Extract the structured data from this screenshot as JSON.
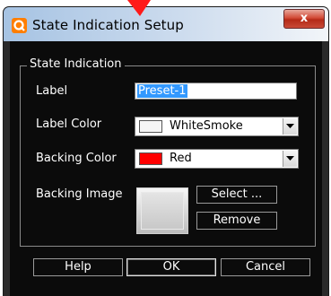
{
  "window": {
    "title": "State Indication Setup",
    "close_label": "x"
  },
  "group": {
    "title": "State Indication"
  },
  "fields": {
    "label": {
      "label": "Label",
      "value": "Preset-1"
    },
    "label_color": {
      "label": "Label Color",
      "value": "WhiteSmoke",
      "swatch": "#f5f5f5"
    },
    "backing_color": {
      "label": "Backing Color",
      "value": "Red",
      "swatch": "#ff0000"
    },
    "backing_image": {
      "label": "Backing Image"
    }
  },
  "buttons": {
    "select": "Select ...",
    "remove": "Remove",
    "help": "Help",
    "ok": "OK",
    "cancel": "Cancel"
  },
  "icons": {
    "app": "app-logo-icon",
    "annotation": "red-arrow-icon",
    "dropdown": "chevron-down-icon"
  },
  "colors": {
    "window_background": "#0b0b0b",
    "selection": "#3399ff",
    "accent_orange": "#ff7e00",
    "annotation_red": "#ff0000"
  }
}
